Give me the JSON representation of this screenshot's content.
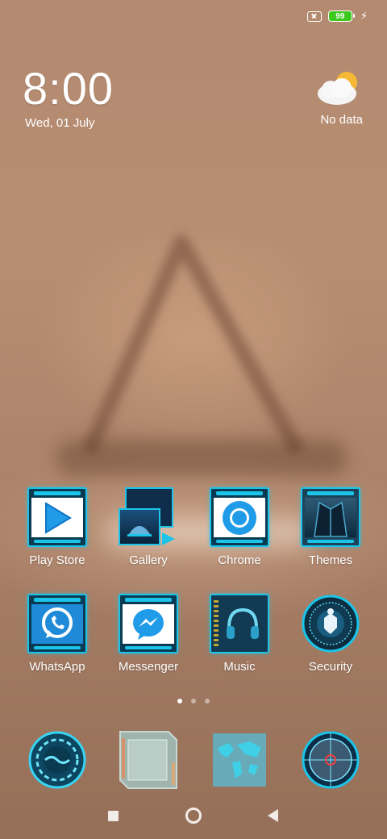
{
  "status_bar": {
    "battery_level": "99",
    "sim_icon": "no-sim-icon",
    "charging_icon": "charging-bolt-icon",
    "battery_color": "#3cc81e"
  },
  "clock": {
    "time": "8:00",
    "date": "Wed, 01 July"
  },
  "weather": {
    "icon": "partly-cloudy-icon",
    "text": "No data"
  },
  "apps": [
    {
      "label": "Play Store",
      "icon": "play-store-icon"
    },
    {
      "label": "Gallery",
      "icon": "gallery-icon"
    },
    {
      "label": "Chrome",
      "icon": "chrome-icon"
    },
    {
      "label": "Themes",
      "icon": "themes-icon"
    },
    {
      "label": "WhatsApp",
      "icon": "whatsapp-icon"
    },
    {
      "label": "Messenger",
      "icon": "messenger-icon"
    },
    {
      "label": "Music",
      "icon": "music-icon"
    },
    {
      "label": "Security",
      "icon": "security-icon"
    }
  ],
  "page_indicator": {
    "pages": 3,
    "active": 1
  },
  "dock": [
    {
      "icon": "phone-dialer-icon"
    },
    {
      "icon": "messages-icon"
    },
    {
      "icon": "browser-map-icon"
    },
    {
      "icon": "camera-icon"
    }
  ],
  "nav": {
    "recents": "recents-icon",
    "home": "home-icon",
    "back": "back-icon"
  },
  "accent_color": "#1bc4e8"
}
